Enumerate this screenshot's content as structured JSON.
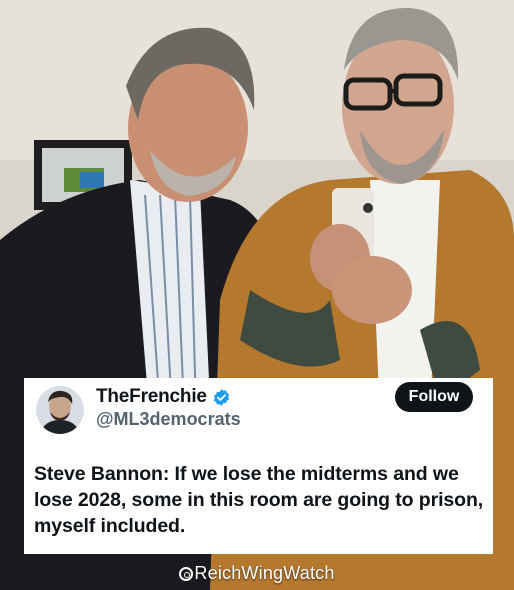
{
  "tweet": {
    "display_name": "TheFrenchie",
    "handle": "@ML3democrats",
    "follow_label": "Follow",
    "text": "Steve Bannon: If we lose the midterms and we lose 2028, some in this room are going to prison, myself included.",
    "verified": true
  },
  "watermark": {
    "text": "ReichWingWatch"
  },
  "colors": {
    "text_primary": "#0f1419",
    "text_secondary": "#536471",
    "verified_blue": "#1d9bf0",
    "follow_button": "#0f1419"
  },
  "icons": {
    "verified": "verified-badge-icon",
    "watermark": "instagram-icon"
  }
}
